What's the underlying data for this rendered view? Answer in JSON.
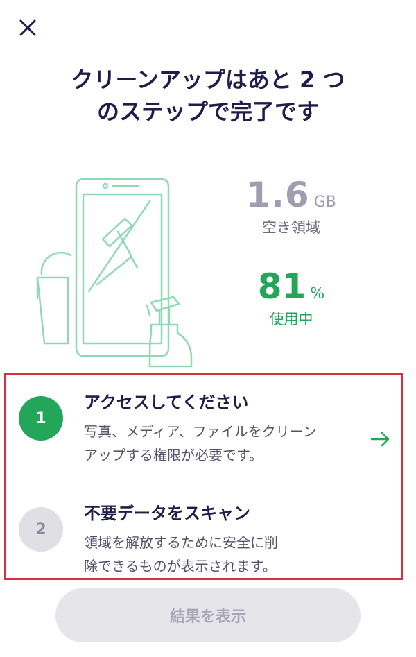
{
  "header": {
    "title_line1": "クリーンアップはあと 2 つ",
    "title_line2": "のステップで完了です"
  },
  "storage": {
    "free_value": "1.6",
    "free_unit": "GB",
    "free_label": "空き領域",
    "used_value": "81",
    "used_unit": "%",
    "used_label": "使用中"
  },
  "steps": [
    {
      "number": "1",
      "title": "アクセスしてください",
      "desc_line1": "写真、メディア、ファイルをクリーン",
      "desc_line2": "アップする権限が必要です。",
      "status": "active"
    },
    {
      "number": "2",
      "title": "不要データをスキャン",
      "desc_line1": "領域を解放するために安全に削",
      "desc_line2": "除できるものが表示されます。",
      "status": "inactive"
    }
  ],
  "buttons": {
    "result_label": "結果を表示"
  },
  "colors": {
    "accent_green": "#23a55a",
    "title_navy": "#1f1d4a",
    "highlight_red": "#d3313b",
    "illustration_mint": "#8fd9b6"
  },
  "icons": {
    "close": "close-icon",
    "arrow": "arrow-right-icon"
  }
}
